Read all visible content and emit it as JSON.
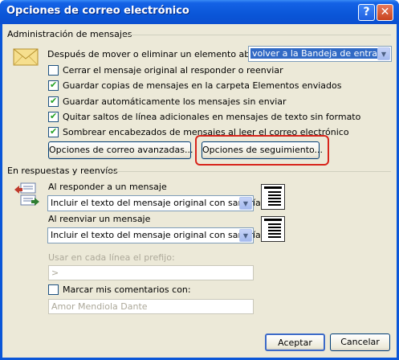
{
  "window": {
    "title": "Opciones de correo electrónico",
    "help_glyph": "?",
    "close_glyph": "✕"
  },
  "admin": {
    "group_label": "Administración de mensajes",
    "after_move_label": "Después de mover o eliminar un elemento abierto:",
    "after_move_value": "volver a la Bandeja de entrada",
    "checkboxes": [
      {
        "label": "Cerrar el mensaje original al responder o reenviar",
        "checked": false
      },
      {
        "label": "Guardar copias de mensajes en la carpeta Elementos enviados",
        "checked": true
      },
      {
        "label": "Guardar automáticamente los mensajes sin enviar",
        "checked": true
      },
      {
        "label": "Quitar saltos de línea adicionales en mensajes de texto sin formato",
        "checked": true
      },
      {
        "label": "Sombrear encabezados de mensajes al leer el correo electrónico",
        "checked": true
      }
    ],
    "advanced_button": "Opciones de correo avanzadas...",
    "tracking_button": "Opciones de seguimiento..."
  },
  "replies": {
    "group_label": "En respuestas y reenvíos",
    "reply_label": "Al responder a un mensaje",
    "reply_value": "Incluir el texto del mensaje original con sangría",
    "forward_label": "Al reenviar un mensaje",
    "forward_value": "Incluir el texto del mensaje original con sangría",
    "prefix_label": "Usar en cada línea el prefijo:",
    "prefix_value": ">",
    "mark_comments_label": "Marcar mis comentarios con:",
    "mark_comments_checked": false,
    "mark_comments_value": "Amor Mendiola Dante"
  },
  "footer": {
    "ok": "Aceptar",
    "cancel": "Cancelar"
  },
  "colors": {
    "titlebar": "#0a56d8",
    "dialog_bg": "#ece9d8",
    "highlight": "#d8241b",
    "selection": "#316ac5"
  },
  "icons": [
    "envelope-icon",
    "reply-forward-icon",
    "dropdown-arrow-icon",
    "message-preview-icon"
  ]
}
